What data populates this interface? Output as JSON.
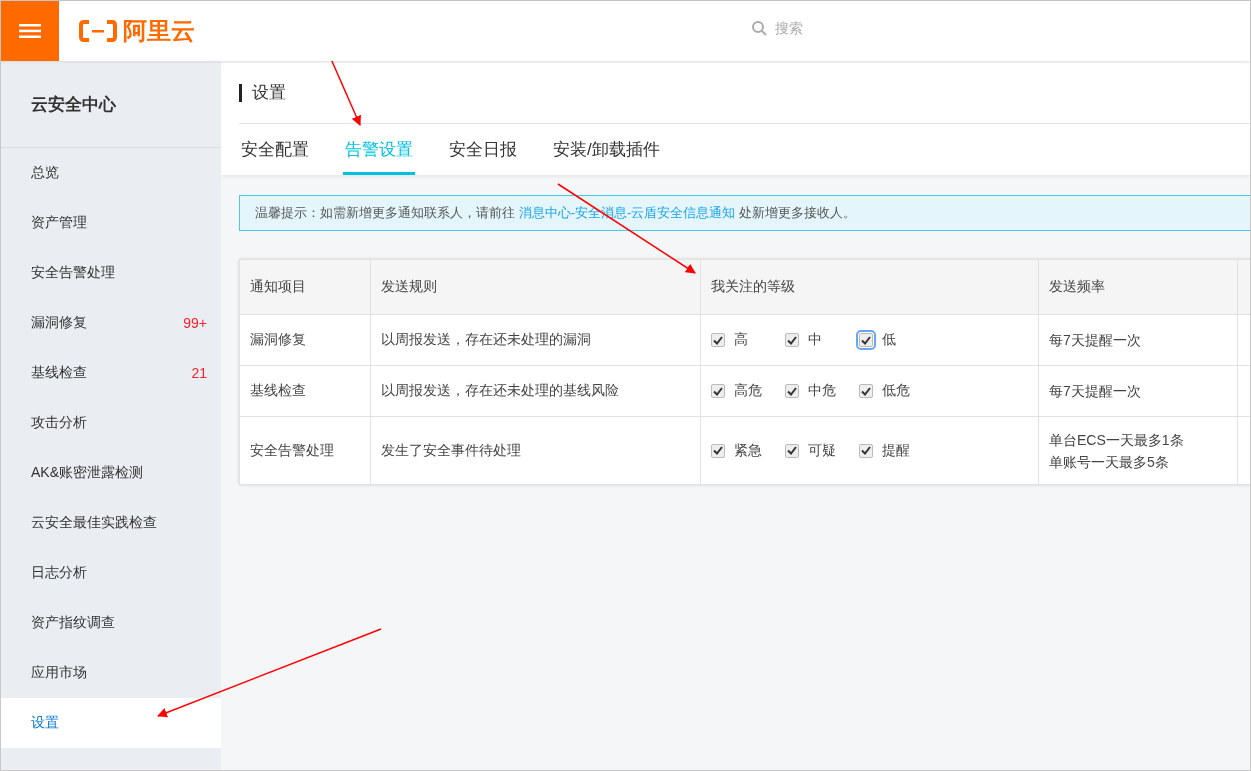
{
  "topbar": {
    "logo": "阿里云",
    "search": {
      "placeholder": "搜索"
    }
  },
  "sidebar": {
    "title": "云安全中心",
    "items": [
      {
        "label": "总览",
        "selected": false
      },
      {
        "label": "资产管理",
        "selected": false
      },
      {
        "label": "安全告警处理",
        "selected": false
      },
      {
        "label": "漏洞修复",
        "badge": "99+",
        "selected": false
      },
      {
        "label": "基线检查",
        "badge": "21",
        "selected": false
      },
      {
        "label": "攻击分析",
        "selected": false
      },
      {
        "label": "AK&账密泄露检测",
        "selected": false
      },
      {
        "label": "云安全最佳实践检查",
        "selected": false
      },
      {
        "label": "日志分析",
        "selected": false
      },
      {
        "label": "资产指纹调查",
        "selected": false
      },
      {
        "label": "应用市场",
        "selected": false
      },
      {
        "label": "设置",
        "selected": true
      }
    ]
  },
  "page": {
    "title": "设置",
    "tabs": [
      {
        "label": "安全配置",
        "selected": false
      },
      {
        "label": "告警设置",
        "selected": true
      },
      {
        "label": "安全日报",
        "selected": false
      },
      {
        "label": "安装/卸载插件",
        "selected": false
      }
    ]
  },
  "notice": {
    "text_before": "温馨提示：如需新增更多通知联系人，请前往 ",
    "link": "消息中心-安全消息-云盾安全信息通知",
    "text_after": " 处新增更多接收人。"
  },
  "table": {
    "columns": [
      "通知项目",
      "发送规则",
      "我关注的等级",
      "发送频率"
    ],
    "rows": [
      {
        "item": "漏洞修复",
        "rule": "以周报发送，存在还未处理的漏洞",
        "levels": [
          {
            "label": "高",
            "checked": true,
            "focused": false
          },
          {
            "label": "中",
            "checked": true,
            "focused": false
          },
          {
            "label": "低",
            "checked": true,
            "focused": true
          }
        ],
        "frequency": [
          "每7天提醒一次"
        ]
      },
      {
        "item": "基线检查",
        "rule": "以周报发送，存在还未处理的基线风险",
        "levels": [
          {
            "label": "高危",
            "checked": true,
            "focused": false
          },
          {
            "label": "中危",
            "checked": true,
            "focused": false
          },
          {
            "label": "低危",
            "checked": true,
            "focused": false
          }
        ],
        "frequency": [
          "每7天提醒一次"
        ]
      },
      {
        "item": "安全告警处理",
        "rule": "发生了安全事件待处理",
        "levels": [
          {
            "label": "紧急",
            "checked": true,
            "focused": false
          },
          {
            "label": "可疑",
            "checked": true,
            "focused": false
          },
          {
            "label": "提醒",
            "checked": true,
            "focused": false
          }
        ],
        "frequency": [
          "单台ECS一天最多1条",
          "单账号一天最多5条"
        ]
      }
    ]
  }
}
